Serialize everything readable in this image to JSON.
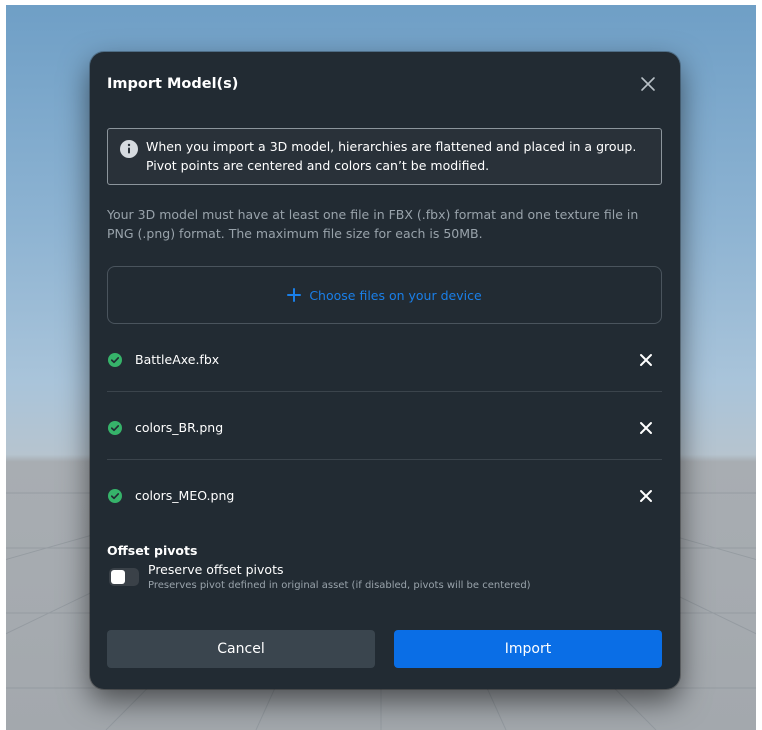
{
  "dialog": {
    "title": "Import Model(s)",
    "info": "When you import a 3D model, hierarchies are flattened and placed in a group. Pivot points are centered and colors can’t be modified.",
    "requirement": "Your 3D model must have at least one file in FBX (.fbx) format and one texture file in PNG (.png) format. The maximum file size for each is 50MB.",
    "dropzone_label": "Choose files on your device",
    "files": [
      {
        "name": "BattleAxe.fbx",
        "status": "uploaded"
      },
      {
        "name": "colors_BR.png",
        "status": "uploaded"
      },
      {
        "name": "colors_MEO.png",
        "status": "uploaded"
      }
    ],
    "offset_pivots": {
      "heading": "Offset pivots",
      "toggle_label": "Preserve offset pivots",
      "toggle_description": "Preserves pivot defined in original asset (if disabled, pivots will be centered)",
      "enabled": false
    },
    "cancel_label": "Cancel",
    "import_label": "Import"
  },
  "colors": {
    "dialog_bg": "#222b33",
    "accent": "#0a6ee6",
    "link": "#1a7fe8",
    "success": "#36b36a"
  },
  "icons": {
    "close": "close-icon",
    "info": "info-icon",
    "add": "plus-icon",
    "check": "check-circle-icon",
    "remove": "close-icon"
  }
}
